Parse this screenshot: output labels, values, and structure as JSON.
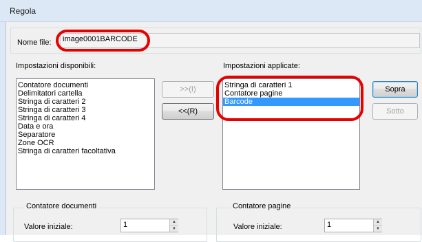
{
  "window": {
    "title": "Regola"
  },
  "file_name": {
    "label": "Nome file:",
    "value": "image0001BARCODE"
  },
  "available": {
    "label": "Impostazioni disponibili:",
    "items": [
      "Contatore documenti",
      "Delimitatori cartella",
      "Stringa di caratteri 2",
      "Stringa di caratteri 3",
      "Stringa di caratteri 4",
      "Data e ora",
      "Separatore",
      "Zone OCR",
      "Stringa di caratteri facoltativa"
    ]
  },
  "applied": {
    "label": "Impostazioni applicate:",
    "items": [
      "Stringa di caratteri 1",
      "Contatore pagine",
      "Barcode"
    ],
    "selected_index": 2
  },
  "buttons": {
    "add": ">>(I)",
    "remove": "<<(R)",
    "up": "Sopra",
    "down": "Sotto"
  },
  "doc_counter": {
    "title": "Contatore documenti",
    "start_label": "Valore iniziale:",
    "start_value": "1"
  },
  "page_counter": {
    "title": "Contatore pagine",
    "start_label": "Valore iniziale:",
    "start_value": "1"
  },
  "colors": {
    "highlight": "#e60000",
    "selection": "#3399ff"
  }
}
